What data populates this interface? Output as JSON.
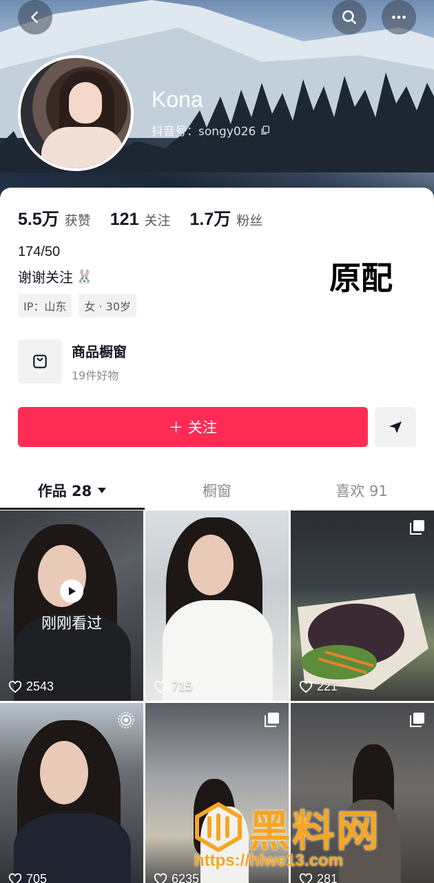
{
  "profile": {
    "name": "Kona",
    "douyin_id": "抖音号：songy026"
  },
  "stats": [
    {
      "num": "5.5万",
      "label": "获赞"
    },
    {
      "num": "121",
      "label": "关注"
    },
    {
      "num": "1.7万",
      "label": "粉丝"
    }
  ],
  "bio": {
    "line1": "174/50",
    "line2": "谢谢关注",
    "emoji": "🐰"
  },
  "overlay_tag": "原配",
  "tags": [
    "IP：山东",
    "女 · 30岁"
  ],
  "shop": {
    "title": "商品橱窗",
    "subtitle": "19件好物"
  },
  "actions": {
    "follow_label": "＋ 关注"
  },
  "tabs": [
    {
      "label": "作品 28",
      "active": true
    },
    {
      "label": "橱窗",
      "active": false
    },
    {
      "label": "喜欢 91",
      "active": false
    }
  ],
  "videos": [
    {
      "likes": "2543",
      "watched_label": "刚刚看过"
    },
    {
      "likes": "715"
    },
    {
      "likes": "221"
    },
    {
      "likes": "705"
    },
    {
      "likes": "6235"
    },
    {
      "likes": "281"
    }
  ],
  "watermark": {
    "text": "黑料网",
    "url": "https://hlwe13.com"
  },
  "colors": {
    "accent": "#fe2c55",
    "watermark": "#f5a623"
  }
}
